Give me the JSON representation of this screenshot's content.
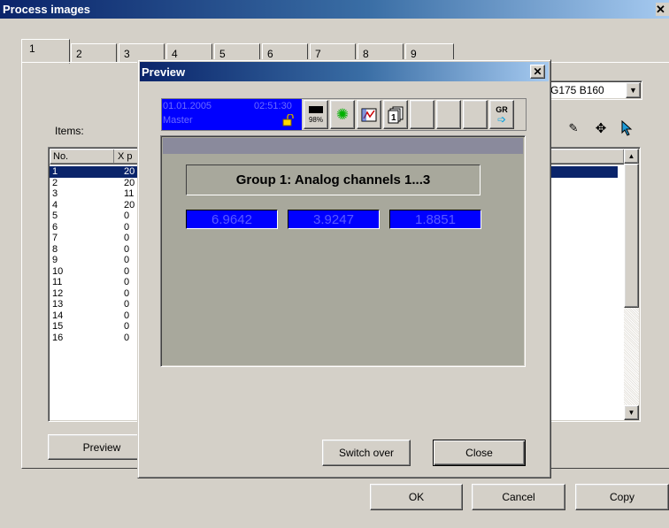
{
  "main_window": {
    "title": "Process images",
    "close_symbol": "✕",
    "tabs": [
      "1",
      "2",
      "3",
      "4",
      "5",
      "6",
      "7",
      "8",
      "9"
    ],
    "items_label": "Items:",
    "group_select_value": "G175 B160",
    "list_headers": [
      "No.",
      "X p"
    ],
    "list_rows": [
      {
        "no": "1",
        "x": "20"
      },
      {
        "no": "2",
        "x": "20"
      },
      {
        "no": "3",
        "x": "11"
      },
      {
        "no": "4",
        "x": "20"
      },
      {
        "no": "5",
        "x": "0"
      },
      {
        "no": "6",
        "x": "0"
      },
      {
        "no": "7",
        "x": "0"
      },
      {
        "no": "8",
        "x": "0"
      },
      {
        "no": "9",
        "x": "0"
      },
      {
        "no": "10",
        "x": "0"
      },
      {
        "no": "11",
        "x": "0"
      },
      {
        "no": "12",
        "x": "0"
      },
      {
        "no": "13",
        "x": "0"
      },
      {
        "no": "14",
        "x": "0"
      },
      {
        "no": "15",
        "x": "0"
      },
      {
        "no": "16",
        "x": "0"
      }
    ],
    "preview_button": "Preview",
    "ok_button": "OK",
    "cancel_button": "Cancel",
    "copy_button": "Copy",
    "tool_icons": [
      "edit-icon",
      "move-icon",
      "pointer-icon"
    ]
  },
  "preview_dialog": {
    "title": "Preview",
    "close_symbol": "✕",
    "status": {
      "date": "01.01.2005",
      "time": "02:51:30",
      "mode": "Master",
      "memory_percent": "98%",
      "lock_icon": "lock-icon"
    },
    "toolbar_icons": [
      "memory-icon",
      "alarm-icon",
      "chart-icon",
      "pages-icon",
      "gr-switch-icon"
    ],
    "gr_label": "GR",
    "group_title": "Group 1: Analog channels 1...3",
    "values": [
      "6.9642",
      "3.9247",
      "1.8851"
    ],
    "switch_over_button": "Switch over",
    "close_button": "Close"
  },
  "colors": {
    "title_bar": "#0a246a",
    "selection": "#0a246a",
    "value_box": "#0000ff",
    "display_bg": "#a8a89c",
    "header_strip": "#8a8a9c"
  }
}
